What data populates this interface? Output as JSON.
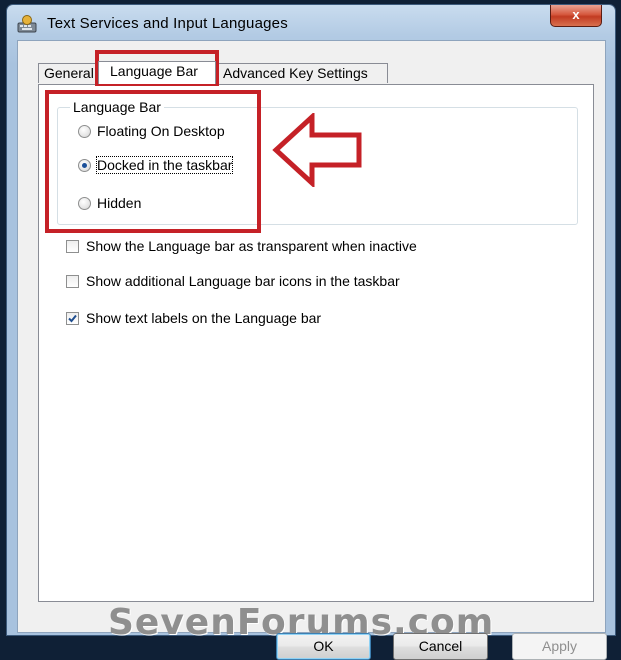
{
  "window": {
    "title": "Text Services and Input Languages",
    "close_label": "x"
  },
  "tabs": [
    {
      "label": "General",
      "active": false
    },
    {
      "label": "Language Bar",
      "active": true
    },
    {
      "label": "Advanced Key Settings",
      "active": false
    }
  ],
  "language_bar_group": {
    "legend": "Language Bar",
    "options": [
      {
        "label": "Floating On Desktop",
        "checked": false
      },
      {
        "label": "Docked in the taskbar",
        "checked": true
      },
      {
        "label": "Hidden",
        "checked": false
      }
    ]
  },
  "checkboxes": [
    {
      "label": "Show the Language bar as transparent when inactive",
      "checked": false
    },
    {
      "label": "Show additional Language bar icons in the taskbar",
      "checked": false
    },
    {
      "label": "Show text labels on the Language bar",
      "checked": true
    }
  ],
  "watermark": "SevenForums.com",
  "buttons": {
    "ok": "OK",
    "cancel": "Cancel",
    "apply": "Apply"
  },
  "colors": {
    "annotation_red": "#c52127",
    "title_bar": "#b3cbe4"
  }
}
